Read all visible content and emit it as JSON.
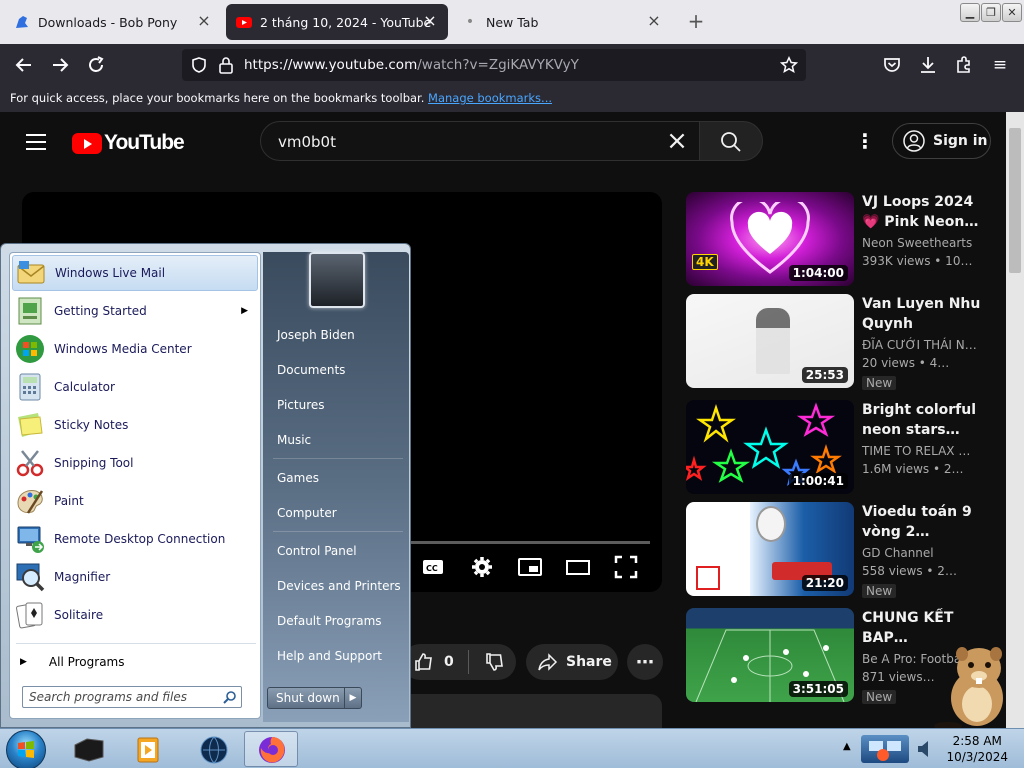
{
  "browser": {
    "tabs": [
      {
        "title": "Downloads - Bob Pony",
        "active": false
      },
      {
        "title": "2 tháng 10, 2024 - YouTube",
        "active": true
      },
      {
        "title": "New Tab",
        "active": false
      }
    ],
    "url_host": "https://www.youtube.com",
    "url_path": "/watch?v=ZgiKAVYKVyY",
    "bookmarks_text": "For quick access, place your bookmarks here on the bookmarks toolbar.",
    "bookmarks_link": "Manage bookmarks...",
    "window_buttons": [
      "minimize",
      "restore",
      "close"
    ]
  },
  "youtube": {
    "logo_text": "YouTube",
    "search_query": "vm0b0t",
    "sign_in": "Sign in",
    "like_count": "0",
    "share_label": "Share",
    "related": [
      {
        "title": "VJ Loops 2024 💗 Pink Neon…",
        "channel": "Neon Sweethearts",
        "meta": "393K views  •  10…",
        "duration": "1:04:00",
        "badge": "4K",
        "is_new": false
      },
      {
        "title": "Van Luyen Nhu Quynh",
        "channel": "ĐĨA CƯỚI THÁI N…",
        "meta": "20 views  •  4…",
        "duration": "25:53",
        "is_new": true
      },
      {
        "title": "Bright colorful neon stars…",
        "channel": "TIME TO RELAX …",
        "meta": "1.6M views  •  2…",
        "duration": "1:00:41",
        "is_new": false
      },
      {
        "title": "Vioedu toán 9 vòng 2…",
        "channel": "GD Channel",
        "meta": "558 views  •  2…",
        "duration": "21:20",
        "is_new": true
      },
      {
        "title": "CHUNG KẾT BAP…",
        "channel": "Be A Pro: Footba…",
        "meta": "871 views…",
        "duration": "3:51:05",
        "is_new": true
      }
    ],
    "new_label": "New"
  },
  "start_menu": {
    "programs": [
      {
        "label": "Windows Live Mail",
        "icon": "mail-icon",
        "highlight": true,
        "submenu": false
      },
      {
        "label": "Getting Started",
        "icon": "getting-started-icon",
        "highlight": false,
        "submenu": true
      },
      {
        "label": "Windows Media Center",
        "icon": "media-center-icon",
        "highlight": false,
        "submenu": false
      },
      {
        "label": "Calculator",
        "icon": "calculator-icon",
        "highlight": false,
        "submenu": false
      },
      {
        "label": "Sticky Notes",
        "icon": "sticky-notes-icon",
        "highlight": false,
        "submenu": false
      },
      {
        "label": "Snipping Tool",
        "icon": "scissors-icon",
        "highlight": false,
        "submenu": false
      },
      {
        "label": "Paint",
        "icon": "paint-palette-icon",
        "highlight": false,
        "submenu": false
      },
      {
        "label": "Remote Desktop Connection",
        "icon": "remote-desktop-icon",
        "highlight": false,
        "submenu": false
      },
      {
        "label": "Magnifier",
        "icon": "magnifier-icon",
        "highlight": false,
        "submenu": false
      },
      {
        "label": "Solitaire",
        "icon": "cards-icon",
        "highlight": false,
        "submenu": false
      }
    ],
    "all_programs": "All Programs",
    "search_placeholder": "Search programs and files",
    "right_links": [
      "Joseph Biden",
      "Documents",
      "Pictures",
      "Music",
      "Games",
      "Computer",
      "Control Panel",
      "Devices and Printers",
      "Default Programs",
      "Help and Support"
    ],
    "shutdown": "Shut down"
  },
  "taskbar": {
    "time": "2:58 AM",
    "date": "10/3/2024"
  },
  "colors": {
    "yt_bg": "#0f0f0f",
    "yt_red": "#ff0000",
    "firefox_chrome": "#2b2a33",
    "link_blue": "#49a6ff"
  }
}
